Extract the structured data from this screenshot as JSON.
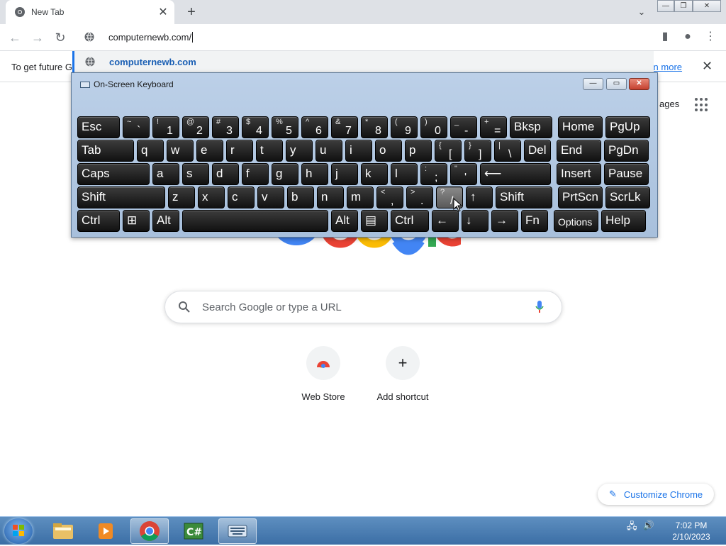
{
  "browser": {
    "tab_title": "New Tab",
    "tab_close": "✕",
    "new_tab": "+",
    "address_text": "computernewb.com/",
    "suggestion": "computernewb.com",
    "infobar_text": "To get future G",
    "infobar_link": "arn more",
    "infobar_close": "✕",
    "window_buttons": [
      "—",
      "❐",
      "✕"
    ]
  },
  "ntp": {
    "images_label": "ages",
    "search_placeholder": "Search Google or type a URL",
    "shortcuts": [
      {
        "label": "Web Store"
      },
      {
        "label": "Add shortcut",
        "icon": "+"
      }
    ],
    "customize_label": "Customize Chrome"
  },
  "osk": {
    "title": "On-Screen Keyboard",
    "buttons": [
      "—",
      "▭",
      "✕"
    ],
    "rows": [
      [
        {
          "p": "Esc"
        },
        {
          "s": "~",
          "b": "`"
        },
        {
          "s": "!",
          "b": "1"
        },
        {
          "s": "@",
          "b": "2"
        },
        {
          "s": "#",
          "b": "3"
        },
        {
          "s": "$",
          "b": "4"
        },
        {
          "s": "%",
          "b": "5"
        },
        {
          "s": "^",
          "b": "6"
        },
        {
          "s": "&",
          "b": "7"
        },
        {
          "s": "*",
          "b": "8"
        },
        {
          "s": "(",
          "b": "9"
        },
        {
          "s": ")",
          "b": "0"
        },
        {
          "s": "_",
          "b": "-"
        },
        {
          "s": "+",
          "b": "="
        },
        {
          "p": "Bksp"
        },
        {
          "p": "Home"
        },
        {
          "p": "PgUp"
        }
      ],
      [
        {
          "p": "Tab"
        },
        {
          "p": "q"
        },
        {
          "p": "w"
        },
        {
          "p": "e"
        },
        {
          "p": "r"
        },
        {
          "p": "t"
        },
        {
          "p": "y"
        },
        {
          "p": "u"
        },
        {
          "p": "i"
        },
        {
          "p": "o"
        },
        {
          "p": "p"
        },
        {
          "s": "{",
          "b": "["
        },
        {
          "s": "}",
          "b": "]"
        },
        {
          "s": "|",
          "b": "\\"
        },
        {
          "p": "Del"
        },
        {
          "p": "End"
        },
        {
          "p": "PgDn"
        }
      ],
      [
        {
          "p": "Caps"
        },
        {
          "p": "a"
        },
        {
          "p": "s"
        },
        {
          "p": "d"
        },
        {
          "p": "f"
        },
        {
          "p": "g"
        },
        {
          "p": "h"
        },
        {
          "p": "j"
        },
        {
          "p": "k"
        },
        {
          "p": "l"
        },
        {
          "s": ":",
          "b": ";"
        },
        {
          "s": "\"",
          "b": "'"
        },
        {
          "p": "⟵"
        },
        {
          "p": "Insert"
        },
        {
          "p": "Pause"
        }
      ],
      [
        {
          "p": "Shift"
        },
        {
          "p": "z"
        },
        {
          "p": "x"
        },
        {
          "p": "c"
        },
        {
          "p": "v"
        },
        {
          "p": "b"
        },
        {
          "p": "n"
        },
        {
          "p": "m"
        },
        {
          "s": "<",
          "b": ","
        },
        {
          "s": ">",
          "b": "."
        },
        {
          "s": "?",
          "b": "/"
        },
        {
          "p": "↑"
        },
        {
          "p": "Shift"
        },
        {
          "p": "PrtScn"
        },
        {
          "p": "ScrLk"
        }
      ],
      [
        {
          "p": "Ctrl"
        },
        {
          "p": "⊞"
        },
        {
          "p": "Alt"
        },
        {
          "p": ""
        },
        {
          "p": "Alt"
        },
        {
          "p": "▤"
        },
        {
          "p": "Ctrl"
        },
        {
          "p": "←"
        },
        {
          "p": "↓"
        },
        {
          "p": "→"
        },
        {
          "p": "Fn"
        },
        {
          "p": "Options"
        },
        {
          "p": "Help"
        }
      ]
    ]
  },
  "taskbar": {
    "items": [
      "explorer",
      "media-player",
      "chrome",
      "csharp",
      "on-screen-keyboard"
    ],
    "time": "7:02 PM",
    "date": "2/10/2023"
  }
}
